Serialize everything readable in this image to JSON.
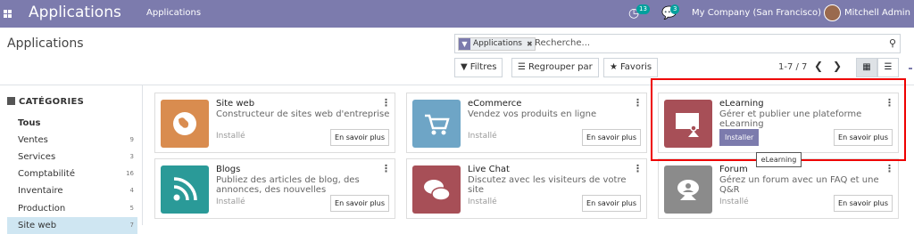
{
  "topbar": {
    "brand": "Applications",
    "menu_app": "Applications",
    "activity_count": "13",
    "messages_count": "3",
    "company": "My Company (San Francisco)",
    "user": "Mitchell Admin",
    "color": "#7c7bad"
  },
  "control_panel": {
    "title": "Applications",
    "search": {
      "facet_icon": "filter-icon",
      "facet_value": "Applications",
      "placeholder": "Recherche...",
      "search_icon": "search-icon"
    },
    "buttons": {
      "filters": "Filtres",
      "group_by": "Regrouper par",
      "favorites": "Favoris"
    },
    "pager": "1-7 / 7"
  },
  "sidebar": {
    "title": "CATÉGORIES",
    "items": [
      {
        "label": "Tous",
        "count": ""
      },
      {
        "label": "Ventes",
        "count": "9"
      },
      {
        "label": "Services",
        "count": "3"
      },
      {
        "label": "Comptabilité",
        "count": "16"
      },
      {
        "label": "Inventaire",
        "count": "4"
      },
      {
        "label": "Production",
        "count": "5"
      },
      {
        "label": "Site web",
        "count": "7"
      }
    ]
  },
  "apps": [
    {
      "name": "Site web",
      "desc": "Constructeur de sites web d'entreprise",
      "status": "Installé",
      "learn": "En savoir plus",
      "color": "#d98c4f",
      "icon": "globe-icon"
    },
    {
      "name": "eCommerce",
      "desc": "Vendez vos produits en ligne",
      "status": "Installé",
      "learn": "En savoir plus",
      "color": "#6ea5c6",
      "icon": "cart-icon"
    },
    {
      "name": "eLearning",
      "desc": "Gérer et publier une plateforme eLearning",
      "install": "Installer",
      "learn": "En savoir plus",
      "color": "#a74f57",
      "icon": "teaching-icon"
    },
    {
      "name": "Blogs",
      "desc": "Publiez des articles de blog, des annonces, des nouvelles",
      "status": "Installé",
      "learn": "En savoir plus",
      "color": "#2a9a98",
      "icon": "rss-icon"
    },
    {
      "name": "Live Chat",
      "desc": "Discutez avec les visiteurs de votre site",
      "status": "Installé",
      "learn": "En savoir plus",
      "color": "#a74f57",
      "icon": "chat-icon"
    },
    {
      "name": "Forum",
      "desc": "Gérez un forum avec un FAQ et une Q&R",
      "status": "Installé",
      "learn": "En savoir plus",
      "color": "#8b8b8b",
      "icon": "forum-icon"
    }
  ],
  "tooltip": "eLearning"
}
